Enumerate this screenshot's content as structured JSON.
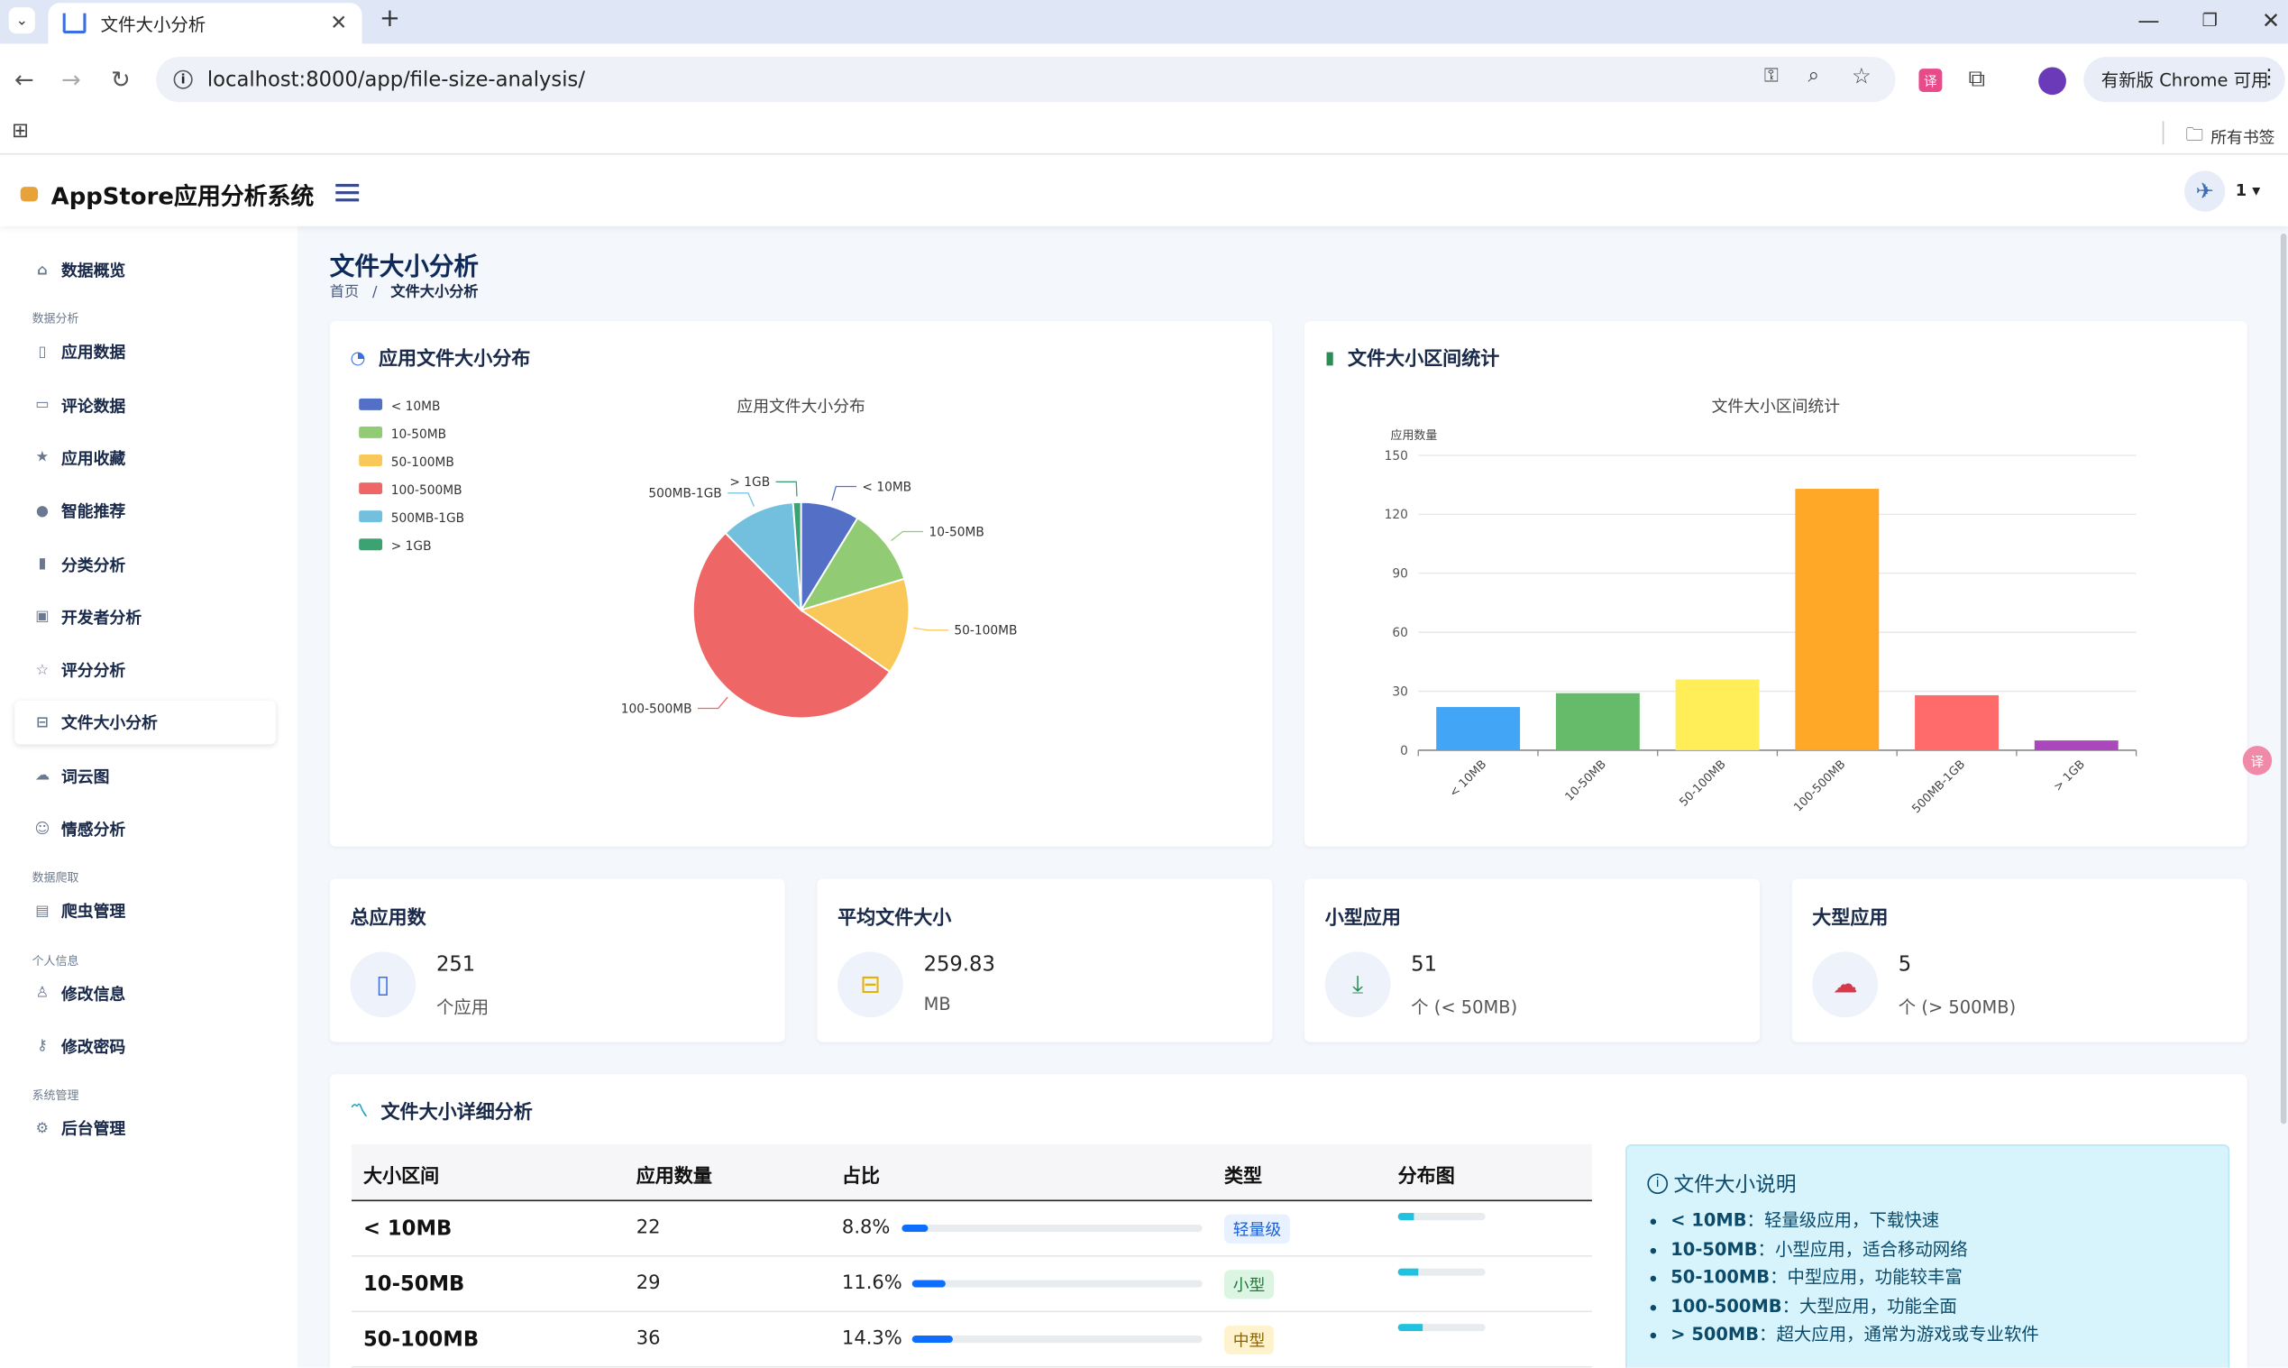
{
  "browser": {
    "tab_title": "文件大小分析",
    "url": "localhost:8000/app/file-size-analysis/",
    "update_button": "有新版 Chrome 可用",
    "bookmarks_label": "所有书签"
  },
  "app": {
    "brand": "AppStore应用分析系统",
    "user": "1"
  },
  "sidebar": {
    "items": [
      {
        "label": "数据概览",
        "icon": "home-icon"
      },
      {
        "section": "数据分析"
      },
      {
        "label": "应用数据",
        "icon": "phone-icon"
      },
      {
        "label": "评论数据",
        "icon": "comment-icon"
      },
      {
        "label": "应用收藏",
        "icon": "star-icon"
      },
      {
        "label": "智能推荐",
        "icon": "bulb-icon"
      },
      {
        "label": "分类分析",
        "icon": "bar-chart-icon"
      },
      {
        "label": "开发者分析",
        "icon": "id-card-icon"
      },
      {
        "label": "评分分析",
        "icon": "star-outline-icon"
      },
      {
        "label": "文件大小分析",
        "icon": "drive-icon",
        "active": true
      },
      {
        "label": "词云图",
        "icon": "cloud-icon"
      },
      {
        "label": "情感分析",
        "icon": "smile-icon"
      },
      {
        "section": "数据爬取"
      },
      {
        "label": "爬虫管理",
        "icon": "bug-icon"
      },
      {
        "section": "个人信息"
      },
      {
        "label": "修改信息",
        "icon": "person-icon"
      },
      {
        "label": "修改密码",
        "icon": "key-icon"
      },
      {
        "section": "系统管理"
      },
      {
        "label": "后台管理",
        "icon": "gear-icon"
      }
    ]
  },
  "page": {
    "title": "文件大小分析",
    "breadcrumb_home": "首页",
    "breadcrumb_sep": "/",
    "breadcrumb_current": "文件大小分析"
  },
  "pie_card": {
    "title": "应用文件大小分布"
  },
  "bar_card": {
    "title": "文件大小区间统计"
  },
  "chart_data": [
    {
      "type": "pie",
      "title": "应用文件大小分布",
      "categories": [
        "< 10MB",
        "10-50MB",
        "50-100MB",
        "100-500MB",
        "500MB-1GB",
        "> 1GB"
      ],
      "values": [
        22,
        29,
        36,
        133,
        28,
        3
      ],
      "colors": [
        "#5470c6",
        "#91cc75",
        "#fac858",
        "#ee6666",
        "#73c0de",
        "#3ba272"
      ],
      "legend": "top-left"
    },
    {
      "type": "bar",
      "title": "文件大小区间统计",
      "ylabel": "应用数量",
      "categories": [
        "< 10MB",
        "10-50MB",
        "50-100MB",
        "100-500MB",
        "500MB-1GB",
        "> 1GB"
      ],
      "values": [
        22,
        29,
        36,
        133,
        28,
        5
      ],
      "colors": [
        "#42a5f5",
        "#66bb6a",
        "#ffee58",
        "#ffa726",
        "#ff6b6b",
        "#ab47bc"
      ],
      "ylim": [
        0,
        150
      ],
      "yticks": [
        0,
        30,
        60,
        90,
        120,
        150
      ],
      "grid": true
    }
  ],
  "stats": [
    {
      "label": "总应用数",
      "value": "251",
      "unit": "个应用",
      "icon": "phone-icon",
      "color": "#3b6fe0"
    },
    {
      "label": "平均文件大小",
      "value": "259.83",
      "unit": "MB",
      "icon": "drive-icon",
      "color": "#e6b100"
    },
    {
      "label": "小型应用",
      "value": "51",
      "unit": "个 (< 50MB)",
      "icon": "download-icon",
      "color": "#2e8b57"
    },
    {
      "label": "大型应用",
      "value": "5",
      "unit": "个 (> 500MB)",
      "icon": "cloud-upload-icon",
      "color": "#d63a4a"
    }
  ],
  "detail": {
    "title": "文件大小详细分析",
    "headers": [
      "大小区间",
      "应用数量",
      "占比",
      "类型",
      "分布图"
    ],
    "rows": [
      {
        "range": "< 10MB",
        "count": "22",
        "pct": "8.8%",
        "pct_value": 8.8,
        "type": "轻量级",
        "type_bg": "#e7f1ff",
        "type_fg": "#1a5fd0"
      },
      {
        "range": "10-50MB",
        "count": "29",
        "pct": "11.6%",
        "pct_value": 11.6,
        "type": "小型",
        "type_bg": "#dcf5e3",
        "type_fg": "#1f7a3a"
      },
      {
        "range": "50-100MB",
        "count": "36",
        "pct": "14.3%",
        "pct_value": 14.3,
        "type": "中型",
        "type_bg": "#fff3cd",
        "type_fg": "#8a6200"
      }
    ],
    "note_title": "文件大小说明",
    "notes": [
      {
        "k": "< 10MB",
        "v": "：轻量级应用，下载快速"
      },
      {
        "k": "10-50MB",
        "v": "：小型应用，适合移动网络"
      },
      {
        "k": "50-100MB",
        "v": "：中型应用，功能较丰富"
      },
      {
        "k": "100-500MB",
        "v": "：大型应用，功能全面"
      },
      {
        "k": "> 500MB",
        "v": "：超大应用，通常为游戏或专业软件"
      }
    ]
  }
}
